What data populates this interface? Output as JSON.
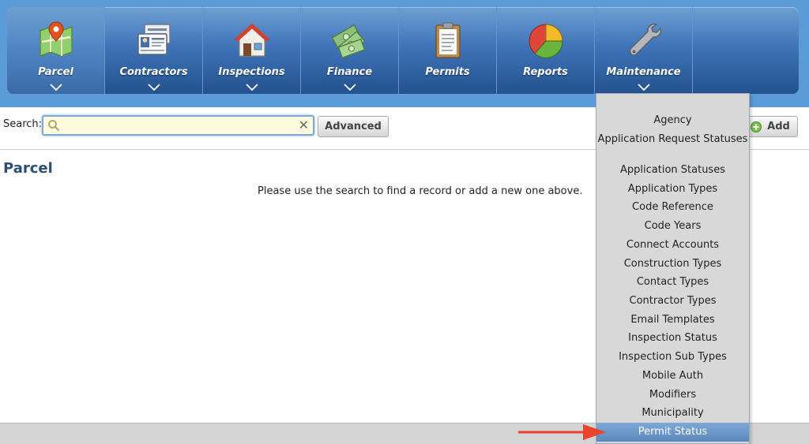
{
  "nav": {
    "items": [
      {
        "label": "Parcel",
        "icon": "map-pin-icon"
      },
      {
        "label": "Contractors",
        "icon": "id-cards-icon"
      },
      {
        "label": "Inspections",
        "icon": "house-icon"
      },
      {
        "label": "Finance",
        "icon": "money-icon"
      },
      {
        "label": "Permits",
        "icon": "clipboard-icon"
      },
      {
        "label": "Reports",
        "icon": "pie-chart-icon"
      },
      {
        "label": "Maintenance",
        "icon": "wrench-icon"
      }
    ],
    "active": "Parcel",
    "open_menu": "Maintenance"
  },
  "search": {
    "label": "Search:",
    "value": "",
    "clear_symbol": "✕",
    "advanced_label": "Advanced",
    "add_label": "Add"
  },
  "main": {
    "title": "Parcel",
    "empty_message": "Please use the search to find a record or add a new one above."
  },
  "dropdown": {
    "items": [
      "Agency",
      "Application Request Statuses",
      "Application Statuses",
      "Application Types",
      "Code Reference",
      "Code Years",
      "Connect Accounts",
      "Construction Types",
      "Contact Types",
      "Contractor Types",
      "Email Templates",
      "Inspection Status",
      "Inspection Sub Types",
      "Mobile Auth",
      "Modifiers",
      "Municipality",
      "Permit Status"
    ],
    "highlighted": "Permit Status"
  },
  "colors": {
    "nav_bg": "#3f74b8",
    "accent_band": "#5b9bd8",
    "search_bg": "#fefcde",
    "title": "#2a4e78",
    "arrow": "#e8452c",
    "dropdown_highlight": "#6a96c8"
  }
}
